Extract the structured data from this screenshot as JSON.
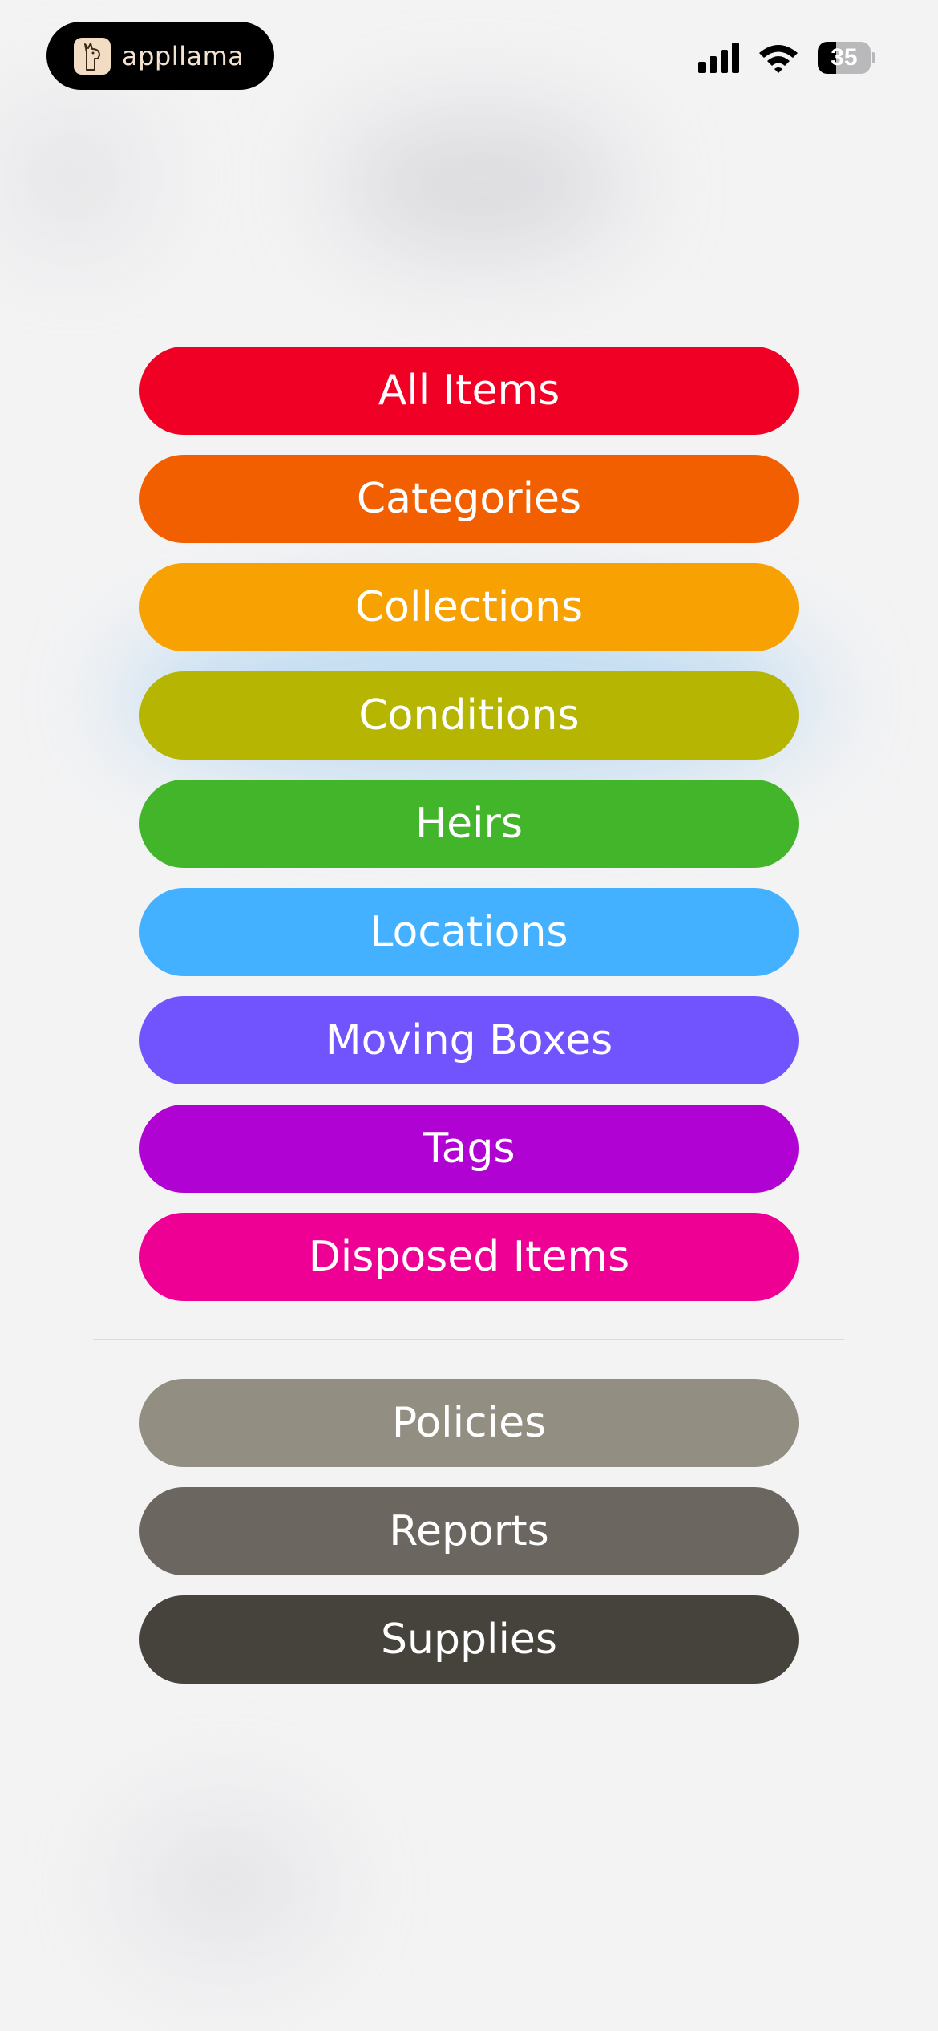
{
  "status_bar": {
    "app_name": "appllama",
    "battery_level": "35",
    "battery_fraction": 0.35
  },
  "menu_primary": [
    {
      "label": "All Items",
      "color": "#ef0024",
      "name": "all-items-button"
    },
    {
      "label": "Categories",
      "color": "#f25f00",
      "name": "categories-button"
    },
    {
      "label": "Collections",
      "color": "#f7a102",
      "name": "collections-button"
    },
    {
      "label": "Conditions",
      "color": "#b6b502",
      "name": "conditions-button"
    },
    {
      "label": "Heirs",
      "color": "#43b52a",
      "name": "heirs-button"
    },
    {
      "label": "Locations",
      "color": "#43b1ff",
      "name": "locations-button"
    },
    {
      "label": "Moving Boxes",
      "color": "#7254fe",
      "name": "moving-boxes-button"
    },
    {
      "label": "Tags",
      "color": "#b002d3",
      "name": "tags-button"
    },
    {
      "label": "Disposed Items",
      "color": "#ef0094",
      "name": "disposed-items-button"
    }
  ],
  "menu_secondary": [
    {
      "label": "Policies",
      "color": "#938e82",
      "name": "policies-button"
    },
    {
      "label": "Reports",
      "color": "#6b6760",
      "name": "reports-button"
    },
    {
      "label": "Supplies",
      "color": "#46433c",
      "name": "supplies-button"
    }
  ]
}
